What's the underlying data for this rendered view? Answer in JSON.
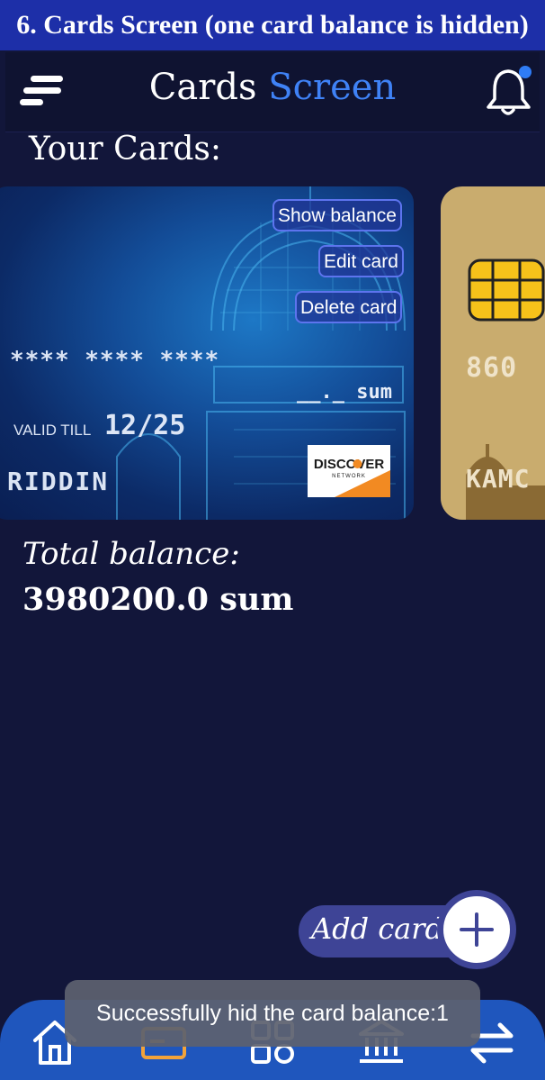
{
  "caption": "6. Cards Screen (one card balance is hidden)",
  "appbar": {
    "title_main": "Cards",
    "title_accent": "Screen",
    "menu_icon": "hamburger-menu-icon",
    "notification_icon": "bell-icon",
    "notification_dot_color": "#2f7cf6"
  },
  "cards_section": {
    "title": "Your Cards:"
  },
  "cards": [
    {
      "menu": {
        "show_balance": "Show balance",
        "edit_card": "Edit card",
        "delete_card": "Delete card"
      },
      "number_masked": "**** **** ****",
      "balance_hidden": "__._ sum",
      "valid_label": "VALID TILL",
      "valid_date": "12/25",
      "holder": "RIDDIN",
      "network": "DISCOVER",
      "network_sub": "NETWORK",
      "color": "#0c2a66"
    },
    {
      "number_partial": "860",
      "holder_partial": "KAMC",
      "color": "#c9ac6e"
    }
  ],
  "total": {
    "label": "Total balance:",
    "value": "3980200.0 sum"
  },
  "add_card": {
    "label": "Add card:",
    "icon": "plus-icon"
  },
  "toast": {
    "message": "Successfully hid the card balance:1"
  },
  "bottom_nav": {
    "items": [
      "home-icon",
      "card-icon",
      "grid-icon",
      "bank-icon",
      "transfer-icon"
    ],
    "active_color": "#f2a33a",
    "bar_color": "#1f56bd"
  }
}
